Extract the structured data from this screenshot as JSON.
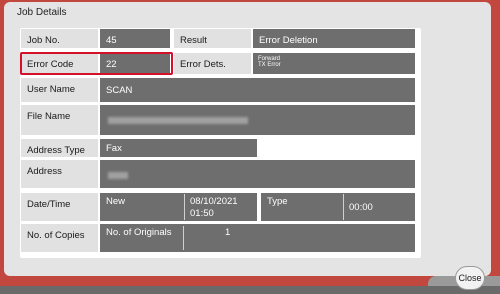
{
  "dialog": {
    "title": "Job Details",
    "close_label": "Close"
  },
  "fields": {
    "job_no": {
      "label": "Job No.",
      "value": "45"
    },
    "result": {
      "label": "Result",
      "value": "Error Deletion"
    },
    "error_code": {
      "label": "Error Code",
      "value": "22"
    },
    "error_dets": {
      "label": "Error Dets.",
      "value_line1": "Forward",
      "value_line2": "TX Error"
    },
    "user_name": {
      "label": "User Name",
      "value": "SCAN"
    },
    "file_name": {
      "label": "File Name"
    },
    "address_type": {
      "label": "Address Type",
      "value": "Fax"
    },
    "address": {
      "label": "Address"
    },
    "date_time": {
      "label": "Date/Time",
      "status": "New",
      "date": "08/10/2021",
      "time": "01:50",
      "type_label": "Type",
      "type_value": "00:00"
    },
    "copies": {
      "label": "No. of Copies",
      "originals_label": "No. of Originals",
      "originals_value": "1"
    }
  }
}
